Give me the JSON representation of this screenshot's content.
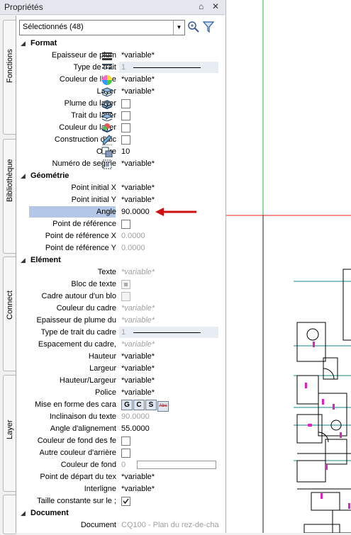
{
  "window": {
    "title": "Propriétés",
    "pin": "↑",
    "close": "✕"
  },
  "side_tabs": [
    "Fonctions",
    "Bibliothèque",
    "Connect",
    "Layer",
    ""
  ],
  "selector": {
    "value": "Sélectionnés (48)"
  },
  "sections": {
    "format": "Format",
    "geometry": "Géométrie",
    "element": "Elément",
    "document": "Document"
  },
  "format": {
    "epaisseur": {
      "label": "Epaisseur de plum",
      "value": "*variable*"
    },
    "type_trait": {
      "label": "Type de trait",
      "value": "1"
    },
    "couleur_ligne": {
      "label": "Couleur de ligne",
      "value": "*variable*"
    },
    "layer": {
      "label": "Layer",
      "value": "*variable*"
    },
    "plume_layer": {
      "label": "Plume du layer"
    },
    "trait_layer": {
      "label": "Trait du layer"
    },
    "couleur_layer": {
      "label": "Couleur du layer"
    },
    "construction": {
      "label": "Construction d'aic"
    },
    "ordre": {
      "label": "Ordre",
      "value": "10"
    },
    "numero": {
      "label": "Numéro de segme",
      "value": "*variable*"
    }
  },
  "geometry": {
    "pix": {
      "label": "Point initial X",
      "value": "*variable*"
    },
    "piy": {
      "label": "Point initial Y",
      "value": "*variable*"
    },
    "angle": {
      "label": "Angle",
      "value": "90.0000"
    },
    "pr": {
      "label": "Point de référence"
    },
    "prx": {
      "label": "Point de référence X",
      "value": "0.0000"
    },
    "pry": {
      "label": "Point de référence Y",
      "value": "0.0000"
    }
  },
  "element": {
    "texte": {
      "label": "Texte",
      "value": "*variable*"
    },
    "bloc": {
      "label": "Bloc de texte"
    },
    "cadre": {
      "label": "Cadre autour d'un blo"
    },
    "couleur_cadre": {
      "label": "Couleur du cadre",
      "value": "*variable*"
    },
    "epaisseur_plume": {
      "label": "Epaisseur de plume du",
      "value": "*variable*"
    },
    "type_trait_cadre": {
      "label": "Type de trait du cadre",
      "value": "1"
    },
    "espacement": {
      "label": "Espacement du cadre,",
      "value": "*variable*"
    },
    "hauteur": {
      "label": "Hauteur",
      "value": "*variable*"
    },
    "largeur": {
      "label": "Largeur",
      "value": "*variable*"
    },
    "hl": {
      "label": "Hauteur/Largeur",
      "value": "*variable*"
    },
    "police": {
      "label": "Police",
      "value": "*variable*"
    },
    "mise_forme": {
      "label": "Mise en forme des cara",
      "buttons": [
        "G",
        "C",
        "S",
        "Abc"
      ]
    },
    "inclinaison": {
      "label": "Inclinaison du texte",
      "value": "90.0000"
    },
    "angle_align": {
      "label": "Angle d'alignement",
      "value": "55.0000"
    },
    "couleur_fond_fe": {
      "label": "Couleur de fond des fe"
    },
    "autre_couleur": {
      "label": "Autre couleur d'arrière"
    },
    "couleur_fond": {
      "label": "Couleur de fond",
      "value": "0"
    },
    "point_depart": {
      "label": "Point de départ du tex",
      "value": "*variable*"
    },
    "interligne": {
      "label": "Interligne",
      "value": "*variable*"
    },
    "taille_constante": {
      "label": "Taille constante sur le ;"
    }
  },
  "document": {
    "doc": {
      "label": "Document",
      "value": "CQ100 - Plan du rez-de-cha"
    }
  },
  "colors": {
    "accent": "#b3c7e6",
    "arrow": "#d01010",
    "cad_green": "#22bb22",
    "cad_red": "#dd2020",
    "cad_teal": "#1a8a8a",
    "cad_magenta": "#e020c0"
  }
}
